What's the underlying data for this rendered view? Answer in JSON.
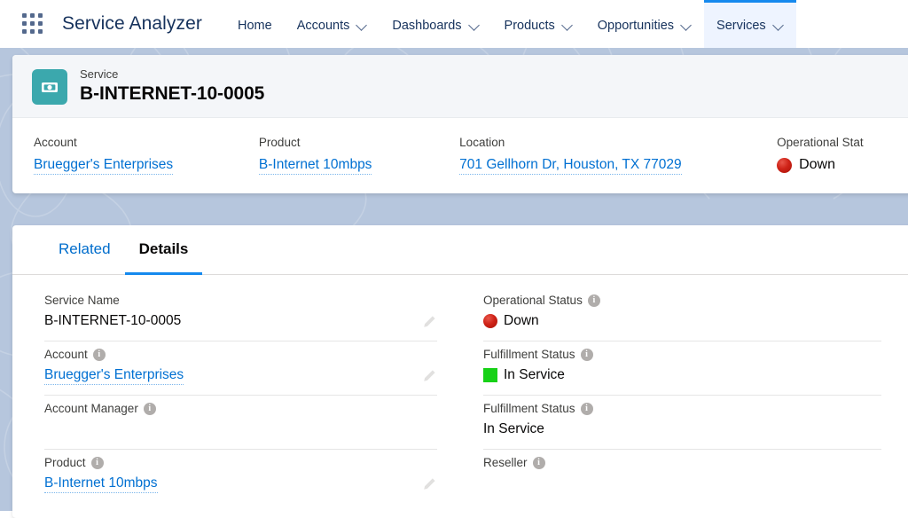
{
  "nav": {
    "app_launcher_icon": "waffle-grid-icon",
    "app_name": "Service Analyzer",
    "items": [
      {
        "label": "Home",
        "has_menu": false,
        "active": false
      },
      {
        "label": "Accounts",
        "has_menu": true,
        "active": false
      },
      {
        "label": "Dashboards",
        "has_menu": true,
        "active": false
      },
      {
        "label": "Products",
        "has_menu": true,
        "active": false
      },
      {
        "label": "Opportunities",
        "has_menu": true,
        "active": false
      },
      {
        "label": "Services",
        "has_menu": true,
        "active": true
      }
    ]
  },
  "record_header": {
    "icon": "service-banknote-icon",
    "object_label": "Service",
    "record_name": "B-INTERNET-10-0005",
    "fields": [
      {
        "label": "Account",
        "value": "Bruegger's Enterprises",
        "type": "link"
      },
      {
        "label": "Product",
        "value": "B-Internet 10mbps",
        "type": "link"
      },
      {
        "label": "Location",
        "value": "701 Gellhorn Dr, Houston, TX 77029",
        "type": "link"
      },
      {
        "label": "Operational Stat",
        "value": "Down",
        "type": "status",
        "indicator": "red-circle"
      }
    ]
  },
  "details_panel": {
    "tabs": [
      {
        "label": "Related",
        "active": false
      },
      {
        "label": "Details",
        "active": true
      }
    ],
    "left_fields": [
      {
        "label": "Service Name",
        "value": "B-INTERNET-10-0005",
        "type": "text",
        "info": false,
        "editable": true
      },
      {
        "label": "Account",
        "value": "Bruegger's Enterprises",
        "type": "link",
        "info": true,
        "editable": true
      },
      {
        "label": "Account Manager",
        "value": "",
        "type": "text",
        "info": true,
        "editable": false
      },
      {
        "label": "Product",
        "value": "B-Internet 10mbps",
        "type": "link",
        "info": true,
        "editable": true
      }
    ],
    "right_fields": [
      {
        "label": "Operational Status",
        "value": "Down",
        "type": "status",
        "indicator": "red-circle",
        "info": true,
        "editable": false
      },
      {
        "label": "Fulfillment Status",
        "value": "In Service",
        "type": "status",
        "indicator": "green-square",
        "info": true,
        "editable": false
      },
      {
        "label": "Fulfillment Status",
        "value": "In Service",
        "type": "text",
        "info": true,
        "editable": false
      },
      {
        "label": "Reseller",
        "value": "",
        "type": "text",
        "info": true,
        "editable": false
      }
    ]
  },
  "colors": {
    "brand_blue": "#1589ee",
    "link_blue": "#0070d2",
    "icon_teal": "#3ba8ad",
    "status_down_red": "#cf2318",
    "status_inservice_green": "#17d117",
    "page_background": "#b6c6dd",
    "header_band": "#f4f6f9"
  }
}
